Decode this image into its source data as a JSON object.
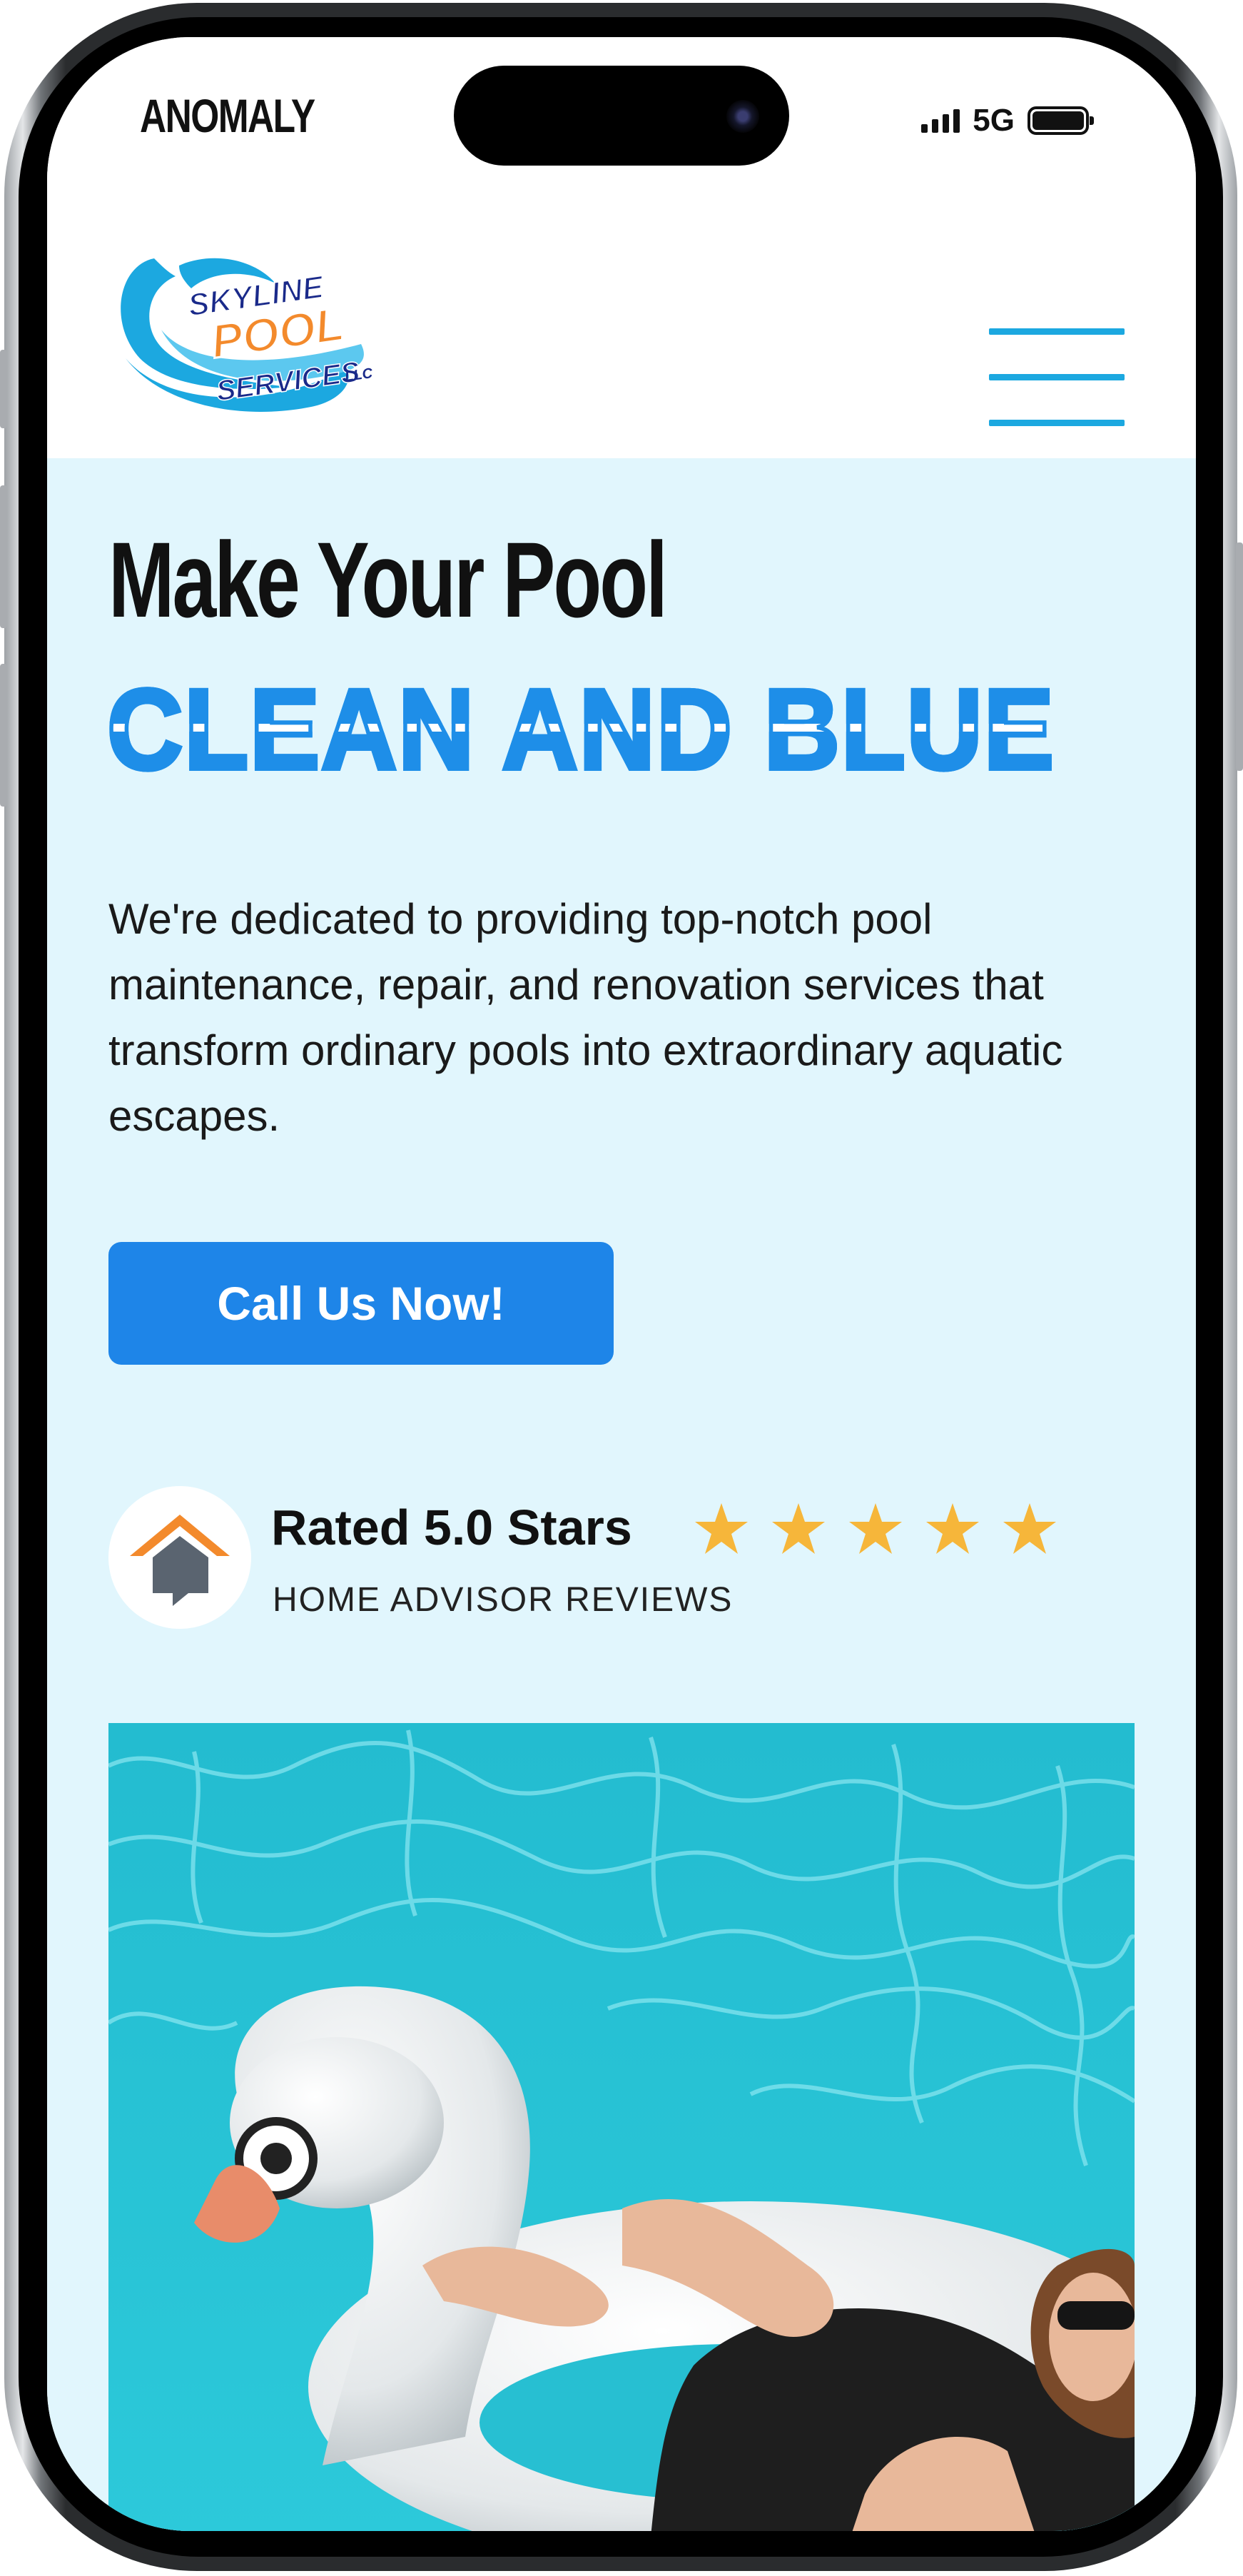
{
  "status_bar": {
    "carrier": "ANOMALY",
    "network": "5G",
    "icons": [
      "signal-bars-icon",
      "battery-icon"
    ]
  },
  "header": {
    "logo": {
      "line1": "SKYLINE",
      "line2": "POOL",
      "line3": "SERVICES",
      "suffix": "LLC"
    },
    "menu_icon": "hamburger-menu-icon"
  },
  "hero": {
    "title": "Make Your Pool",
    "subtitle": "CLEAN AND BLUE",
    "description": "We're dedicated to providing top-notch pool maintenance, repair, and renovation services that transform ordinary pools into extraordinary aquatic escapes.",
    "cta_label": "Call Us Now!"
  },
  "rating": {
    "title": "Rated 5.0 Stars",
    "stars": 5,
    "max_stars": 5,
    "source": "HOME ADVISOR REVIEWS",
    "icon": "home-advisor-logo-icon"
  },
  "colors": {
    "accent_blue": "#1e85e8",
    "hero_background": "#e1f6fd",
    "menu_lines": "#1ca8e0",
    "star": "#f6b63a",
    "logo_orange": "#f38a2c",
    "logo_navy": "#1a2a8a"
  },
  "photo": {
    "subject": "woman-on-swan-float-image"
  }
}
